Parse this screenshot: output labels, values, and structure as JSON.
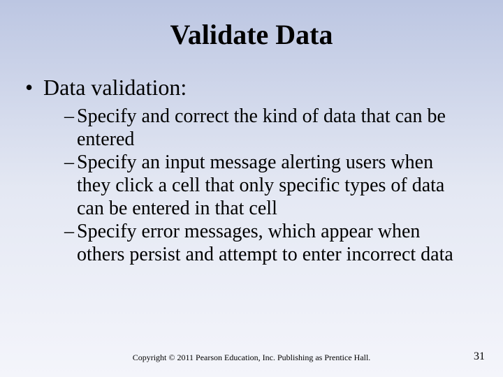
{
  "title": "Validate Data",
  "bullet1": "Data validation:",
  "sub": {
    "a": "Specify and correct the kind of data that can be entered",
    "b": "Specify an input message alerting users when they click a cell that only specific types of data can be entered in that cell",
    "c": "Specify error messages, which appear when others persist and attempt to enter incorrect data"
  },
  "copyright": "Copyright © 2011 Pearson Education, Inc. Publishing as Prentice Hall.",
  "page": "31"
}
